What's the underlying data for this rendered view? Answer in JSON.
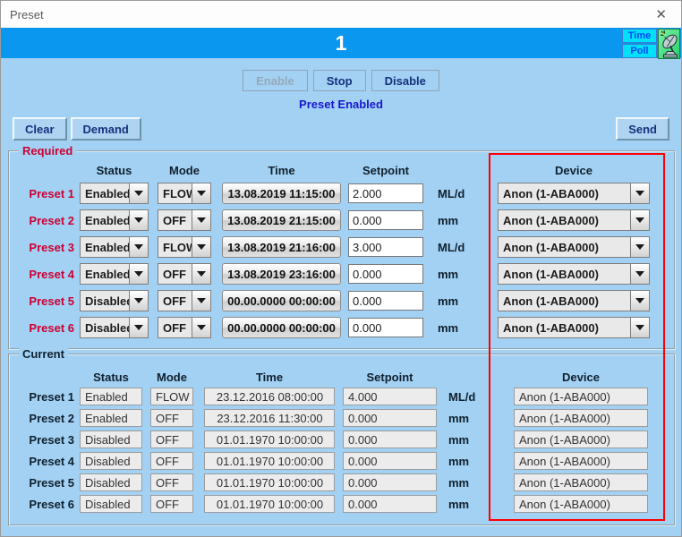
{
  "window": {
    "title": "Preset",
    "close_glyph": "✕"
  },
  "banner": {
    "title": "1",
    "time_label": "Time",
    "poll_label": "Poll"
  },
  "controls": {
    "enable": "Enable",
    "stop": "Stop",
    "disable": "Disable",
    "status_text": "Preset Enabled",
    "clear": "Clear",
    "demand": "Demand",
    "send": "Send"
  },
  "required": {
    "legend": "Required",
    "headers": {
      "status": "Status",
      "mode": "Mode",
      "time": "Time",
      "setpoint": "Setpoint",
      "device": "Device"
    },
    "rows": [
      {
        "label": "Preset 1",
        "status": "Enabled",
        "mode": "FLOW",
        "time": "13.08.2019 11:15:00",
        "setpoint": "2.000",
        "unit": "ML/d",
        "device": "Anon (1-ABA000)"
      },
      {
        "label": "Preset 2",
        "status": "Enabled",
        "mode": "OFF",
        "time": "13.08.2019 21:15:00",
        "setpoint": "0.000",
        "unit": "mm",
        "device": "Anon (1-ABA000)"
      },
      {
        "label": "Preset 3",
        "status": "Enabled",
        "mode": "FLOW",
        "time": "13.08.2019 21:16:00",
        "setpoint": "3.000",
        "unit": "ML/d",
        "device": "Anon (1-ABA000)"
      },
      {
        "label": "Preset 4",
        "status": "Enabled",
        "mode": "OFF",
        "time": "13.08.2019 23:16:00",
        "setpoint": "0.000",
        "unit": "mm",
        "device": "Anon (1-ABA000)"
      },
      {
        "label": "Preset 5",
        "status": "Disabled",
        "mode": "OFF",
        "time": "00.00.0000 00:00:00",
        "setpoint": "0.000",
        "unit": "mm",
        "device": "Anon (1-ABA000)"
      },
      {
        "label": "Preset 6",
        "status": "Disabled",
        "mode": "OFF",
        "time": "00.00.0000 00:00:00",
        "setpoint": "0.000",
        "unit": "mm",
        "device": "Anon (1-ABA000)"
      }
    ]
  },
  "current": {
    "legend": "Current",
    "headers": {
      "status": "Status",
      "mode": "Mode",
      "time": "Time",
      "setpoint": "Setpoint",
      "device": "Device"
    },
    "rows": [
      {
        "label": "Preset 1",
        "status": "Enabled",
        "mode": "FLOW",
        "time": "23.12.2016 08:00:00",
        "setpoint": "4.000",
        "unit": "ML/d",
        "device": "Anon (1-ABA000)"
      },
      {
        "label": "Preset 2",
        "status": "Enabled",
        "mode": "OFF",
        "time": "23.12.2016 11:30:00",
        "setpoint": "0.000",
        "unit": "mm",
        "device": "Anon (1-ABA000)"
      },
      {
        "label": "Preset 3",
        "status": "Disabled",
        "mode": "OFF",
        "time": "01.01.1970 10:00:00",
        "setpoint": "0.000",
        "unit": "mm",
        "device": "Anon (1-ABA000)"
      },
      {
        "label": "Preset 4",
        "status": "Disabled",
        "mode": "OFF",
        "time": "01.01.1970 10:00:00",
        "setpoint": "0.000",
        "unit": "mm",
        "device": "Anon (1-ABA000)"
      },
      {
        "label": "Preset 5",
        "status": "Disabled",
        "mode": "OFF",
        "time": "01.01.1970 10:00:00",
        "setpoint": "0.000",
        "unit": "mm",
        "device": "Anon (1-ABA000)"
      },
      {
        "label": "Preset 6",
        "status": "Disabled",
        "mode": "OFF",
        "time": "01.01.1970 10:00:00",
        "setpoint": "0.000",
        "unit": "mm",
        "device": "Anon (1-ABA000)"
      }
    ]
  },
  "colors": {
    "banner_blue": "#0a97f0",
    "dialog_background": "#a3d1f3",
    "highlight_red": "#ff0000",
    "required_label_red": "#cc0033",
    "status_text_blue": "#1717cf",
    "time_poll_cyan": "#00e0f8",
    "icon_green": "#4ae489"
  }
}
